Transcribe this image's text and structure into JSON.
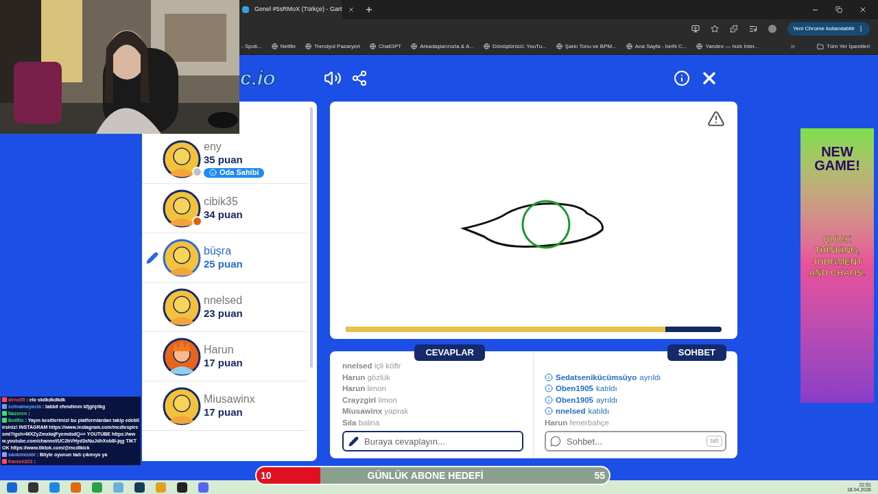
{
  "browser": {
    "tab": {
      "title": "Genel #5sRMoX (Türkçe) - Gart"
    },
    "update_button": "Yeni Chrome kullanılabilir",
    "bookmarks": [
      "- Spoti...",
      "Netflix",
      "Trendyol Pazaryeri",
      "ChatGPT",
      "Arkadaşlarınızla & A...",
      "Dönüştürücü: YouTu...",
      "Şarkı Tonu ve BPM...",
      "Ana Sayfa - beIN C...",
      "Yandex — hızlı İnter..."
    ],
    "all_bookmarks": "Tüm Yer İşaretleri"
  },
  "game": {
    "logo": "c.io",
    "players": [
      {
        "name": "eny",
        "score": "35 puan",
        "badge": "Oda Sahibi",
        "drawing": false,
        "kind": "bald",
        "color": "#c0c0c0"
      },
      {
        "name": "cibik35",
        "score": "34 puan",
        "drawing": false,
        "kind": "bald",
        "color": "#d9660f"
      },
      {
        "name": "büşra",
        "score": "25 puan",
        "drawing": true,
        "kind": "bald"
      },
      {
        "name": "nnelsed",
        "score": "23 puan",
        "drawing": false,
        "kind": "bald"
      },
      {
        "name": "Harun",
        "score": "17 puan",
        "drawing": false,
        "kind": "spiky"
      },
      {
        "name": "Miusawinx",
        "score": "17 puan",
        "drawing": false,
        "kind": "bald"
      }
    ],
    "timer": {
      "level": 0.85
    },
    "answers": {
      "title": "CEVAPLAR",
      "items": [
        {
          "user": "nnelsed",
          "text": "içli köftr"
        },
        {
          "user": "Harun",
          "text": "gözlük"
        },
        {
          "user": "Harun",
          "text": "limon"
        },
        {
          "user": "Crayzgirl",
          "text": "limon"
        },
        {
          "user": "Miusawinx",
          "text": "yaprak"
        },
        {
          "user": "Sıla",
          "text": "balina"
        }
      ],
      "placeholder": "Buraya cevaplayın..."
    },
    "chat": {
      "title": "SOHBET",
      "items": [
        {
          "kind": "info",
          "user": "Sedatsenikücümsüyo",
          "text": "ayrıldı"
        },
        {
          "kind": "info",
          "user": "Oben1905",
          "text": "katıldı"
        },
        {
          "kind": "info",
          "user": "Oben1905",
          "text": "ayrıldı"
        },
        {
          "kind": "info",
          "user": "nnelsed",
          "text": "katıldı"
        },
        {
          "kind": "message",
          "user": "Harun",
          "text": "fenerbahçe"
        }
      ],
      "placeholder": "Sohbet...",
      "key_hint": "tab"
    },
    "ad": {
      "headline": "NEW GAME!",
      "tagline": "QUICK THINKING, JUDGMENT AND CHAOS!"
    }
  },
  "stream_chat": [
    {
      "user": "deno05",
      "text": ": elo skdkdkdkdk",
      "color": "#ff4a5a"
    },
    {
      "user": "selinamayasta",
      "text": ": tabbil efendimm kfjghjrlkg",
      "color": "#5aa0ff"
    },
    {
      "user": "Nazeren",
      "text": ":",
      "color": "#3ddc6b"
    },
    {
      "user": "BotRix",
      "text": ": Yayın kesitlerimizi bu platformlardan takip edebilirsiniz! INSTAGRAM https://www.instagram.com/mcdlespiresmi?igsh=MXZyZmxkajFyemdsdQ== YOUTUBE https://www.youtube.com/channel/UC2bVHyd3sNuJdhXob8l-jqg TIKTOK https://www.tiktok.com/@mcdlkick",
      "color": "#3ddc6b"
    },
    {
      "user": "sankimizabi",
      "text": ": Böyle oyunun tadı çıkmıyo ya",
      "color": "#8a9cff"
    },
    {
      "user": "Kareen323",
      "text": ":",
      "color": "#ff4a5a"
    }
  ],
  "goal": {
    "current": "10",
    "title": "GÜNLÜK ABONE HEDEFİ",
    "target": "55",
    "level": 0.18
  },
  "taskbar": {
    "time": "22:51",
    "date": "18.04.2026"
  }
}
